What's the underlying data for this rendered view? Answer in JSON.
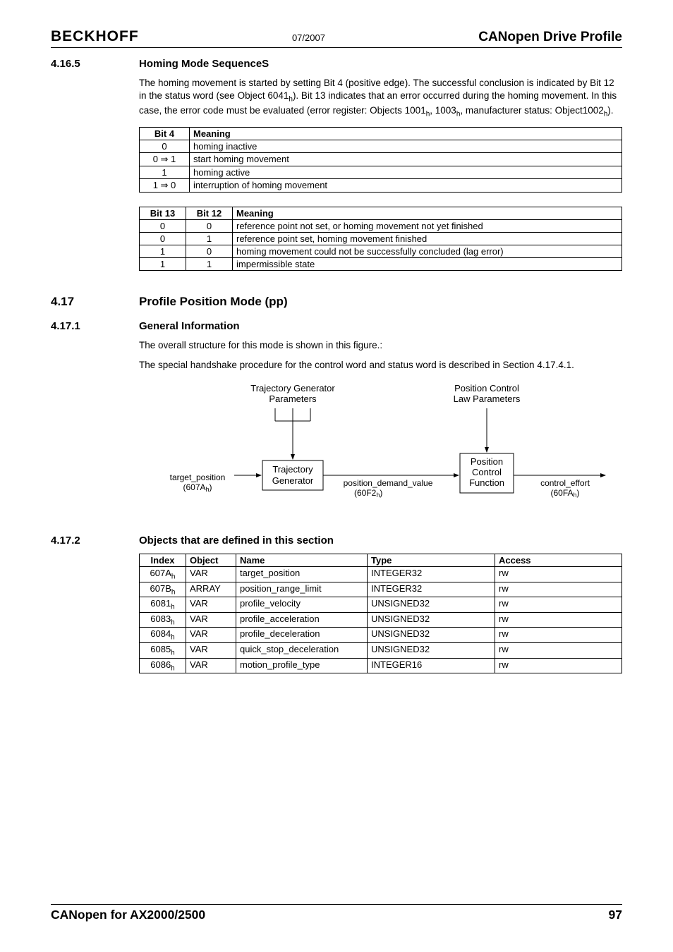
{
  "hdr": {
    "left": "BECKHOFF",
    "mid": "07/2007",
    "right": "CANopen Drive Profile"
  },
  "s1": {
    "num": "4.16.5",
    "title": "Homing Mode SequenceS",
    "p1a": "The homing movement is started by setting Bit 4 (positive edge). The successful conclusion is indicated by Bit 12 in the status word (see Object 6041",
    "p1b": "). Bit 13 indicates that an error occurred during the homing movement. In this case, the error code must be evaluated (error register: Objects 1001",
    "p1c": ", 1003",
    "p1d": ", manufacturer status: Object1002",
    "p1e": ")."
  },
  "t1": {
    "h": [
      "Bit 4",
      "Meaning"
    ],
    "r": [
      [
        "0",
        "homing inactive"
      ],
      [
        "0 ⇒ 1",
        "start homing movement"
      ],
      [
        "1",
        "homing active"
      ],
      [
        "1 ⇒ 0",
        "interruption of homing movement"
      ]
    ]
  },
  "t2": {
    "h": [
      "Bit 13",
      "Bit 12",
      "Meaning"
    ],
    "r": [
      [
        "0",
        "0",
        "reference point not set, or homing movement not yet finished"
      ],
      [
        "0",
        "1",
        "reference point set, homing movement finished"
      ],
      [
        "1",
        "0",
        "homing movement could not be successfully concluded (lag error)"
      ],
      [
        "1",
        "1",
        "impermissible state"
      ]
    ]
  },
  "s2": {
    "num": "4.17",
    "title": "Profile Position Mode (pp)"
  },
  "s3": {
    "num": "4.17.1",
    "title": "General Information",
    "p1": "The overall structure for this mode is shown in this figure.:",
    "p2": "The special handshake procedure for the control word and status word is described in Section 4.17.4.1."
  },
  "diagram": {
    "lbl1": "Trajectory Generator",
    "lbl1b": "Parameters",
    "lbl2": "Position Control",
    "lbl2b": "Law Parameters",
    "box1a": "Trajectory",
    "box1b": "Generator",
    "box2a": "Position",
    "box2b": "Control",
    "box2c": "Function",
    "in1": "target_position",
    "in1b": "(607A",
    "mid": "position_demand_value",
    "midb": "(60F2",
    "out": "control_effort",
    "outb": "(60FA"
  },
  "s4": {
    "num": "4.17.2",
    "title": "Objects that are defined in this section"
  },
  "t3": {
    "h": [
      "Index",
      "Object",
      "Name",
      "Type",
      "Access"
    ],
    "r": [
      [
        "607A",
        "VAR",
        "target_position",
        "INTEGER32",
        "rw"
      ],
      [
        "607B",
        "ARRAY",
        "position_range_limit",
        "INTEGER32",
        "rw"
      ],
      [
        "6081",
        "VAR",
        "profile_velocity",
        "UNSIGNED32",
        "rw"
      ],
      [
        "6083",
        "VAR",
        "profile_acceleration",
        "UNSIGNED32",
        "rw"
      ],
      [
        "6084",
        "VAR",
        "profile_deceleration",
        "UNSIGNED32",
        "rw"
      ],
      [
        "6085",
        "VAR",
        "quick_stop_deceleration",
        "UNSIGNED32",
        "rw"
      ],
      [
        "6086",
        "VAR",
        "motion_profile_type",
        "INTEGER16",
        "rw"
      ]
    ]
  },
  "ftr": {
    "left": "CANopen for AX2000/2500",
    "right": "97"
  }
}
